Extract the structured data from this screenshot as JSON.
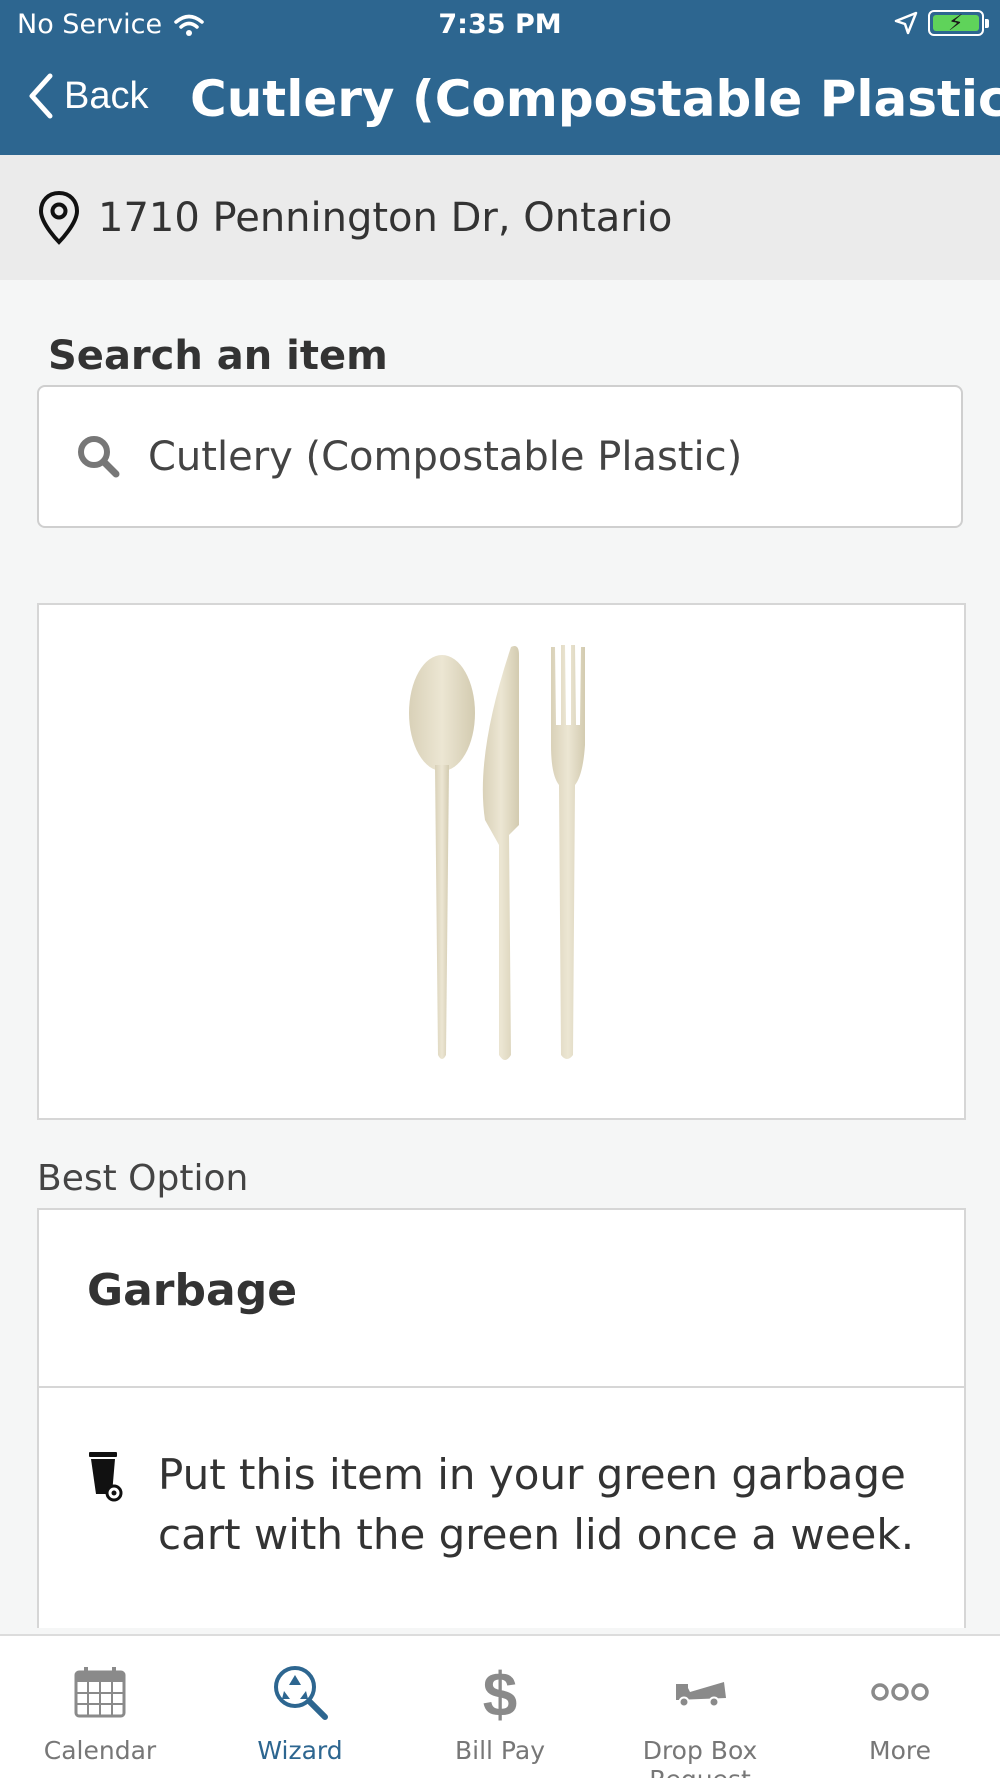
{
  "status_bar": {
    "carrier": "No Service",
    "time": "7:35 PM"
  },
  "nav": {
    "back_label": "Back",
    "title": "Cutlery (Compostable Plastic)"
  },
  "address": {
    "text": "1710 Pennington Dr, Ontario"
  },
  "search": {
    "label": "Search an item",
    "value": "Cutlery (Compostable Plastic)"
  },
  "best_option": {
    "label": "Best Option",
    "title": "Garbage",
    "description": "Put this item in your green garbage cart with the green lid once a week."
  },
  "tabs": [
    {
      "label": "Calendar",
      "icon": "calendar-icon",
      "active": false
    },
    {
      "label": "Wizard",
      "icon": "wizard-recycle-search-icon",
      "active": true
    },
    {
      "label": "Bill Pay",
      "icon": "dollar-icon",
      "active": false
    },
    {
      "label": "Drop Box Request",
      "icon": "truck-icon",
      "active": false
    },
    {
      "label": "More",
      "icon": "more-dots-icon",
      "active": false
    }
  ],
  "colors": {
    "header": "#2d6690",
    "active_tab": "#2d6690",
    "battery": "#5fd35a"
  }
}
